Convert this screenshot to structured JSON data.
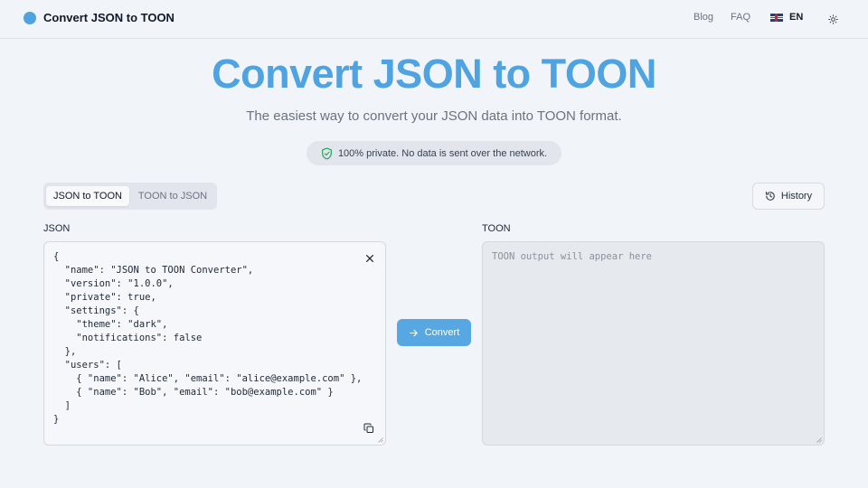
{
  "header": {
    "app_title": "Convert JSON to TOON",
    "nav": {
      "blog": "Blog",
      "faq": "FAQ"
    },
    "language": "EN",
    "icons": {
      "logo": "circle-logo-icon",
      "flag": "uk-flag-icon",
      "theme": "sun-icon"
    }
  },
  "hero": {
    "title": "Convert JSON to TOON",
    "subtitle": "The easiest way to convert your JSON data into TOON format.",
    "privacy_note": "100% private. No data is sent over the network."
  },
  "tabs": [
    {
      "label": "JSON to TOON",
      "active": true
    },
    {
      "label": "TOON to JSON",
      "active": false
    }
  ],
  "history_label": "History",
  "input_panel": {
    "label": "JSON",
    "value": "{\n  \"name\": \"JSON to TOON Converter\",\n  \"version\": \"1.0.0\",\n  \"private\": true,\n  \"settings\": {\n    \"theme\": \"dark\",\n    \"notifications\": false\n  },\n  \"users\": [\n    { \"name\": \"Alice\", \"email\": \"alice@example.com\" },\n    { \"name\": \"Bob\", \"email\": \"bob@example.com\" }\n  ]\n}"
  },
  "convert_label": "Convert",
  "output_panel": {
    "label": "TOON",
    "placeholder": "TOON output will appear here"
  },
  "colors": {
    "accent": "#4fa3e0",
    "button": "#57a7e3",
    "background": "#f1f4f8",
    "shield": "#22a55a"
  }
}
